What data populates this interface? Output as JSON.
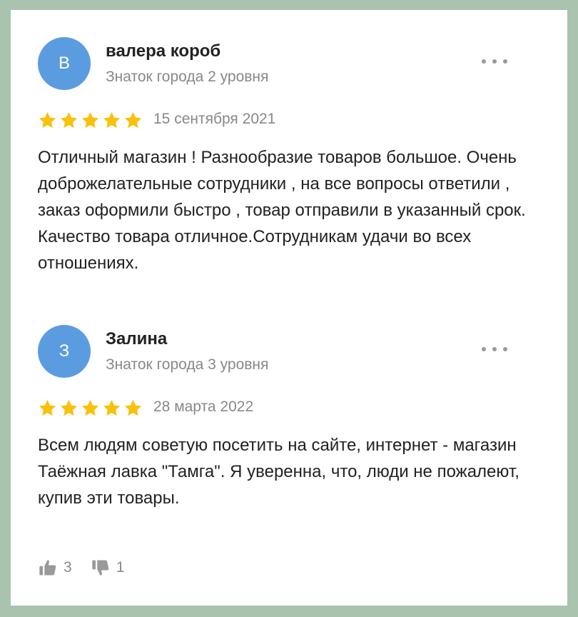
{
  "reviews": [
    {
      "avatar_letter": "В",
      "author": "валера короб",
      "level": "Знаток города 2 уровня",
      "rating": 5,
      "date": "15 сентября 2021",
      "text": "Отличный магазин ! Разнообразие товаров большое. Очень доброжелательные сотрудники , на все вопросы ответили , заказ оформили быстро , товар отправили в указанный срок. Качество товара отличное.Сотрудникам удачи во всех отношениях."
    },
    {
      "avatar_letter": "З",
      "author": "Залина",
      "level": "Знаток города 3 уровня",
      "rating": 5,
      "date": "28 марта 2022",
      "text": "Всем людям советую посетить на сайте, интернет - магазин Таёжная лавка \"Тамга\". Я уверенна, что, люди не пожалеют, купив эти товары.",
      "likes": "3",
      "dislikes": "1"
    }
  ],
  "icons": {
    "star": "star-icon",
    "more": "more-dots-icon",
    "like": "thumbs-up-icon",
    "dislike": "thumbs-down-icon"
  },
  "colors": {
    "background": "#a9c3ae",
    "card": "#ffffff",
    "avatar": "#5b9ce0",
    "star": "#f9c10a",
    "muted_text": "#888888",
    "main_text": "#222222"
  }
}
